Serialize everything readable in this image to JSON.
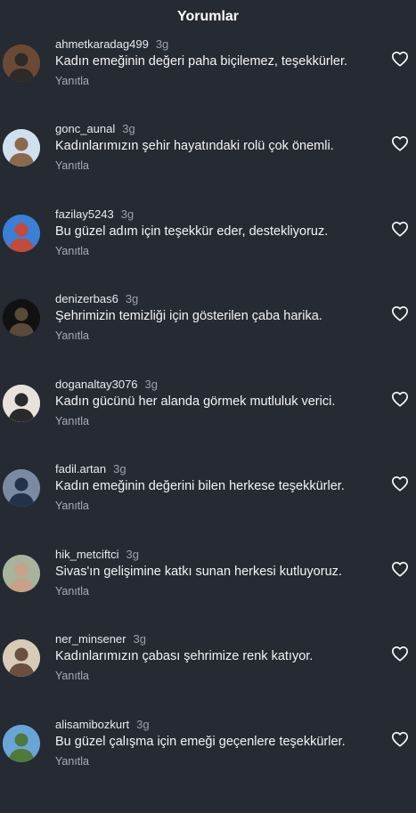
{
  "header": {
    "title": "Yorumlar"
  },
  "comments": [
    {
      "user": "ahmetkaradag499",
      "time": "3g",
      "text": "Kadın emeğinin değeri paha biçilemez, teşekkürler.",
      "reply": "Yanıtla",
      "avatar_colors": [
        "#6a4a36",
        "#2e2a28"
      ]
    },
    {
      "user": "gonc_aunal",
      "time": "3g",
      "text": "Kadınlarımızın şehir hayatındaki rolü çok önemli.",
      "reply": "Yanıtla",
      "avatar_colors": [
        "#cfe0ee",
        "#8a6a4a"
      ]
    },
    {
      "user": "fazilay5243",
      "time": "3g",
      "text": "Bu güzel adım için teşekkür eder, destekliyoruz.",
      "reply": "Yanıtla",
      "avatar_colors": [
        "#3b7fd6",
        "#c44a3a"
      ]
    },
    {
      "user": "denizerbas6",
      "time": "3g",
      "text": "Şehrimizin temizliği için gösterilen çaba harika.",
      "reply": "Yanıtla",
      "avatar_colors": [
        "#111111",
        "#5a4a3a"
      ]
    },
    {
      "user": "doganaltay3076",
      "time": "3g",
      "text": "Kadın gücünü her alanda görmek mutluluk verici.",
      "reply": "Yanıtla",
      "avatar_colors": [
        "#e8e2dc",
        "#2a2a2a"
      ]
    },
    {
      "user": "fadil.artan",
      "time": "3g",
      "text": "Kadın emeğinin değerini bilen herkese teşekkürler.",
      "reply": "Yanıtla",
      "avatar_colors": [
        "#7a8aa0",
        "#22324a"
      ]
    },
    {
      "user": "hik_metciftci",
      "time": "3g",
      "text": "Sivas'ın gelişimine katkı sunan herkesi kutluyoruz.",
      "reply": "Yanıtla",
      "avatar_colors": [
        "#a7b39a",
        "#c9a088"
      ]
    },
    {
      "user": "ner_minsener",
      "time": "3g",
      "text": "Kadınlarımızın çabası şehrimize renk katıyor.",
      "reply": "Yanıtla",
      "avatar_colors": [
        "#d8cbb8",
        "#6a5040"
      ]
    },
    {
      "user": "alisamibozkurt",
      "time": "3g",
      "text": "Bu güzel çalışma için emeği geçenlere teşekkürler.",
      "reply": "Yanıtla",
      "avatar_colors": [
        "#6aa5d8",
        "#4f7a3a"
      ]
    }
  ],
  "icons": {
    "like": "heart-outline-icon"
  },
  "colors": {
    "background": "#262a33",
    "text": "#ffffff",
    "muted": "#9ca0a8"
  }
}
